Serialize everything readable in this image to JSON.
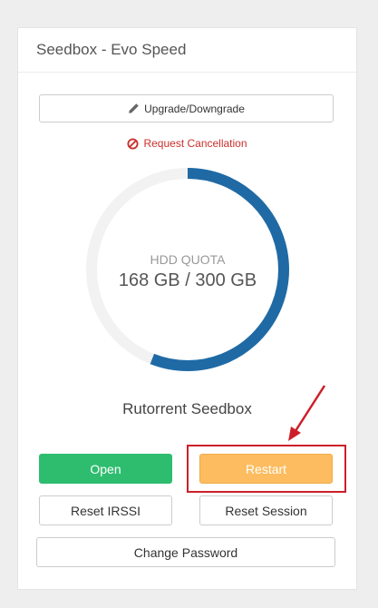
{
  "card": {
    "title": "Seedbox - Evo Speed"
  },
  "actions": {
    "upgrade_label": "Upgrade/Downgrade",
    "cancel_label": "Request Cancellation"
  },
  "quota": {
    "label": "HDD QUOTA",
    "value_text": "168 GB / 300 GB",
    "used_gb": 168,
    "total_gb": 300
  },
  "service": {
    "name": "Rutorrent Seedbox",
    "open_label": "Open",
    "restart_label": "Restart",
    "reset_irssi_label": "Reset IRSSI",
    "reset_session_label": "Reset Session",
    "change_password_label": "Change Password"
  },
  "colors": {
    "gauge_fill": "#1f6aa5",
    "gauge_track": "#f2f2f2",
    "open": "#2ebd6e",
    "restart": "#fdbc5f",
    "annotation": "#cc1f2a"
  }
}
